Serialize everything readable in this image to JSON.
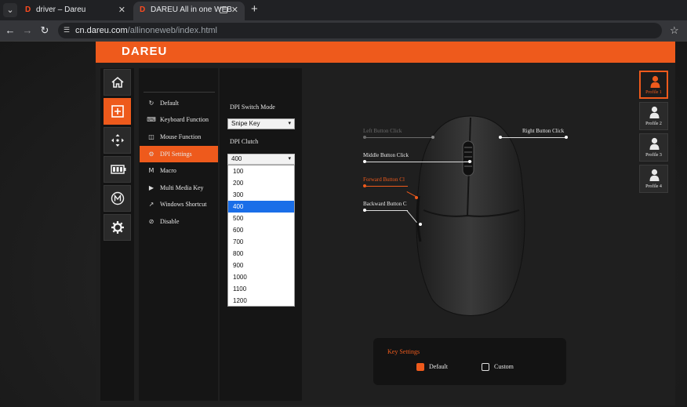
{
  "browser": {
    "tabs": [
      {
        "title": "driver – Dareu",
        "active": false
      },
      {
        "title": "DAREU All in one WEB",
        "active": true
      }
    ],
    "url_host": "cn.dareu.com",
    "url_path": "/allinoneweb/index.html"
  },
  "brand": "DAREU",
  "menu": {
    "items": [
      {
        "label": "Default",
        "icon": "refresh-icon",
        "glyph": "↻",
        "active": false
      },
      {
        "label": "Keyboard Function",
        "icon": "keyboard-icon",
        "glyph": "⌨",
        "active": false
      },
      {
        "label": "Mouse Function",
        "icon": "mouse-icon",
        "glyph": "◫",
        "active": false
      },
      {
        "label": "DPI Settings",
        "icon": "dpi-icon",
        "glyph": "⚙",
        "active": true
      },
      {
        "label": "Macro",
        "icon": "macro-icon",
        "glyph": "M",
        "active": false
      },
      {
        "label": "Multi Media Key",
        "icon": "media-icon",
        "glyph": "▶",
        "active": false
      },
      {
        "label": "Windows Shortcut",
        "icon": "shortcut-arrow-icon",
        "glyph": "↗",
        "active": false
      },
      {
        "label": "Disable",
        "icon": "disable-icon",
        "glyph": "⊘",
        "active": false
      }
    ]
  },
  "dpi": {
    "switch_mode_label": "DPI Switch Mode",
    "switch_mode_value": "Snipe Key",
    "clutch_label": "DPI Clutch",
    "clutch_value": "400",
    "options": [
      "100",
      "200",
      "300",
      "400",
      "500",
      "600",
      "700",
      "800",
      "900",
      "1000",
      "1100",
      "1200"
    ],
    "selected_index": 3
  },
  "mouse_labels": {
    "left": "Left Button Click",
    "right": "Right Button Click",
    "middle": "Middle Button Click",
    "forward": "Forward Button Cl",
    "backward": "Backward Button C"
  },
  "key_settings": {
    "title": "Key Settings",
    "default_label": "Default",
    "custom_label": "Custom",
    "selected": "Default"
  },
  "profiles": [
    {
      "label": "Profile 1",
      "active": true
    },
    {
      "label": "Profile 2",
      "active": false
    },
    {
      "label": "Profile 3",
      "active": false
    },
    {
      "label": "Profile 4",
      "active": false
    }
  ],
  "colors": {
    "accent": "#ee5a1c",
    "selected_option": "#1a6ee8"
  }
}
